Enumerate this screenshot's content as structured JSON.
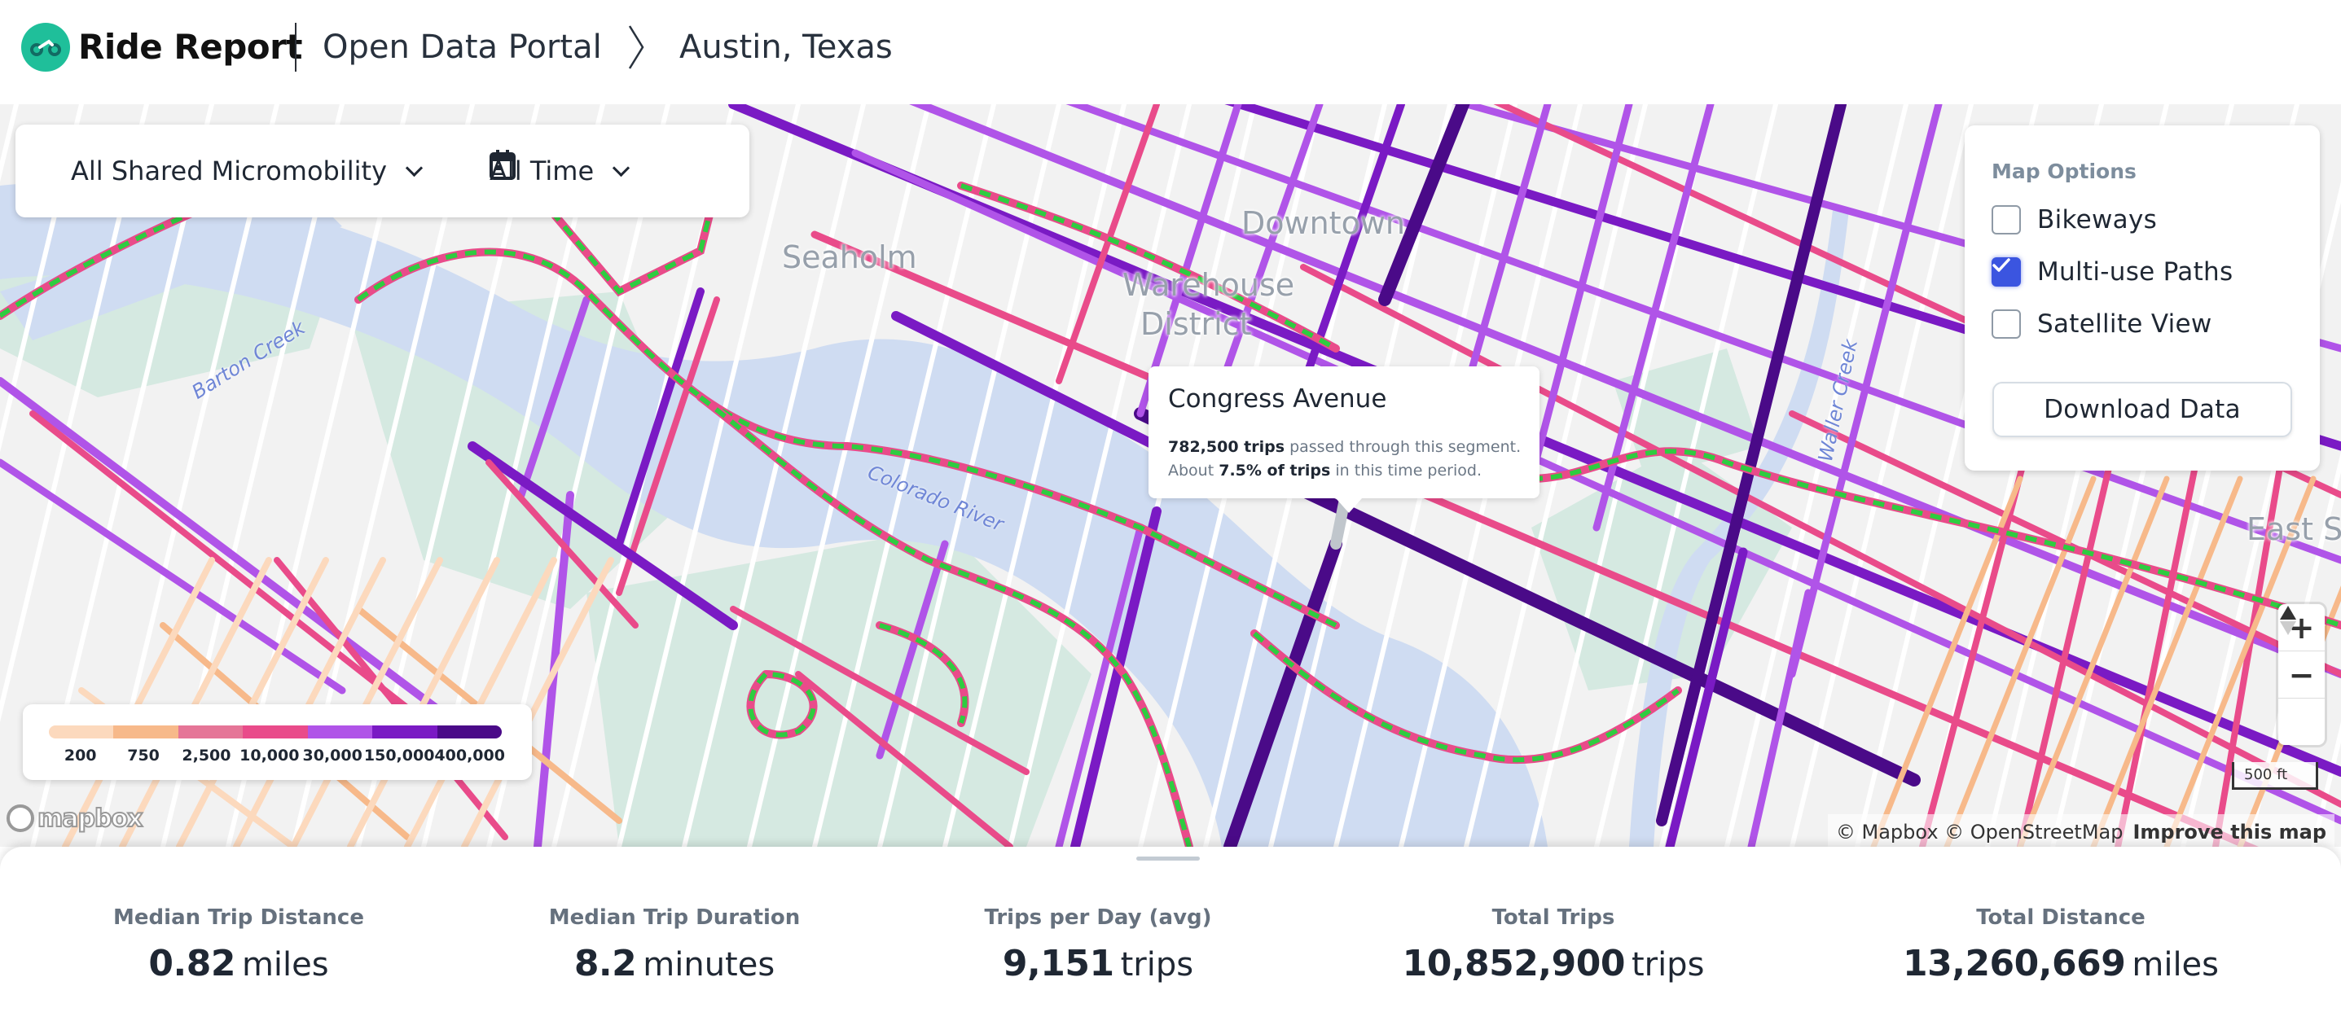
{
  "header": {
    "brand": "Ride Report",
    "breadcrumb": [
      "Open Data Portal",
      "Austin, Texas"
    ],
    "logo_color": "#1fbf9a"
  },
  "filters": {
    "mode": "All Shared Micromobility",
    "time": "All Time"
  },
  "map_options": {
    "title": "Map Options",
    "items": [
      {
        "label": "Bikeways",
        "checked": false
      },
      {
        "label": "Multi-use Paths",
        "checked": true
      },
      {
        "label": "Satellite View",
        "checked": false
      }
    ],
    "download_label": "Download Data",
    "accent": "#3b55e0"
  },
  "tooltip": {
    "title": "Congress Avenue",
    "trips_bold": "782,500 trips",
    "trips_rest": " passed through this segment.",
    "share_pre": "About ",
    "share_bold": "7.5% of trips",
    "share_rest": " in this time period."
  },
  "legend": {
    "stops": [
      {
        "label": "200",
        "color": "#fcd9bd"
      },
      {
        "label": "750",
        "color": "#f7b98a"
      },
      {
        "label": "2,500",
        "color": "#e57597"
      },
      {
        "label": "10,000",
        "color": "#e94b8a"
      },
      {
        "label": "30,000",
        "color": "#b054e8"
      },
      {
        "label": "150,000",
        "color": "#7a1ac4"
      },
      {
        "label": "400,000",
        "color": "#4a0a88"
      }
    ],
    "multi_use_path_color": "#2ecc40"
  },
  "map_labels": {
    "places": [
      {
        "name": "Downtown"
      },
      {
        "name": "Warehouse"
      },
      {
        "name": "District"
      },
      {
        "name": "Seaholm"
      },
      {
        "name": "East S"
      }
    ],
    "water": [
      {
        "name": "Barton Creek"
      },
      {
        "name": "Colorado River"
      },
      {
        "name": "Waller Creek"
      }
    ]
  },
  "map_controls": {
    "zoom_in": "+",
    "zoom_out": "−",
    "compass": "▲",
    "scale": "500 ft",
    "mapbox_logo": "mapbox",
    "attribution": "© Mapbox © OpenStreetMap",
    "improve": "Improve this map"
  },
  "stats": [
    {
      "label": "Median Trip Distance",
      "value": "0.82",
      "unit": "miles"
    },
    {
      "label": "Median Trip Duration",
      "value": "8.2",
      "unit": "minutes"
    },
    {
      "label": "Trips per Day (avg)",
      "value": "9,151",
      "unit": "trips"
    },
    {
      "label": "Total Trips",
      "value": "10,852,900",
      "unit": "trips"
    },
    {
      "label": "Total Distance",
      "value": "13,260,669",
      "unit": "miles"
    }
  ]
}
